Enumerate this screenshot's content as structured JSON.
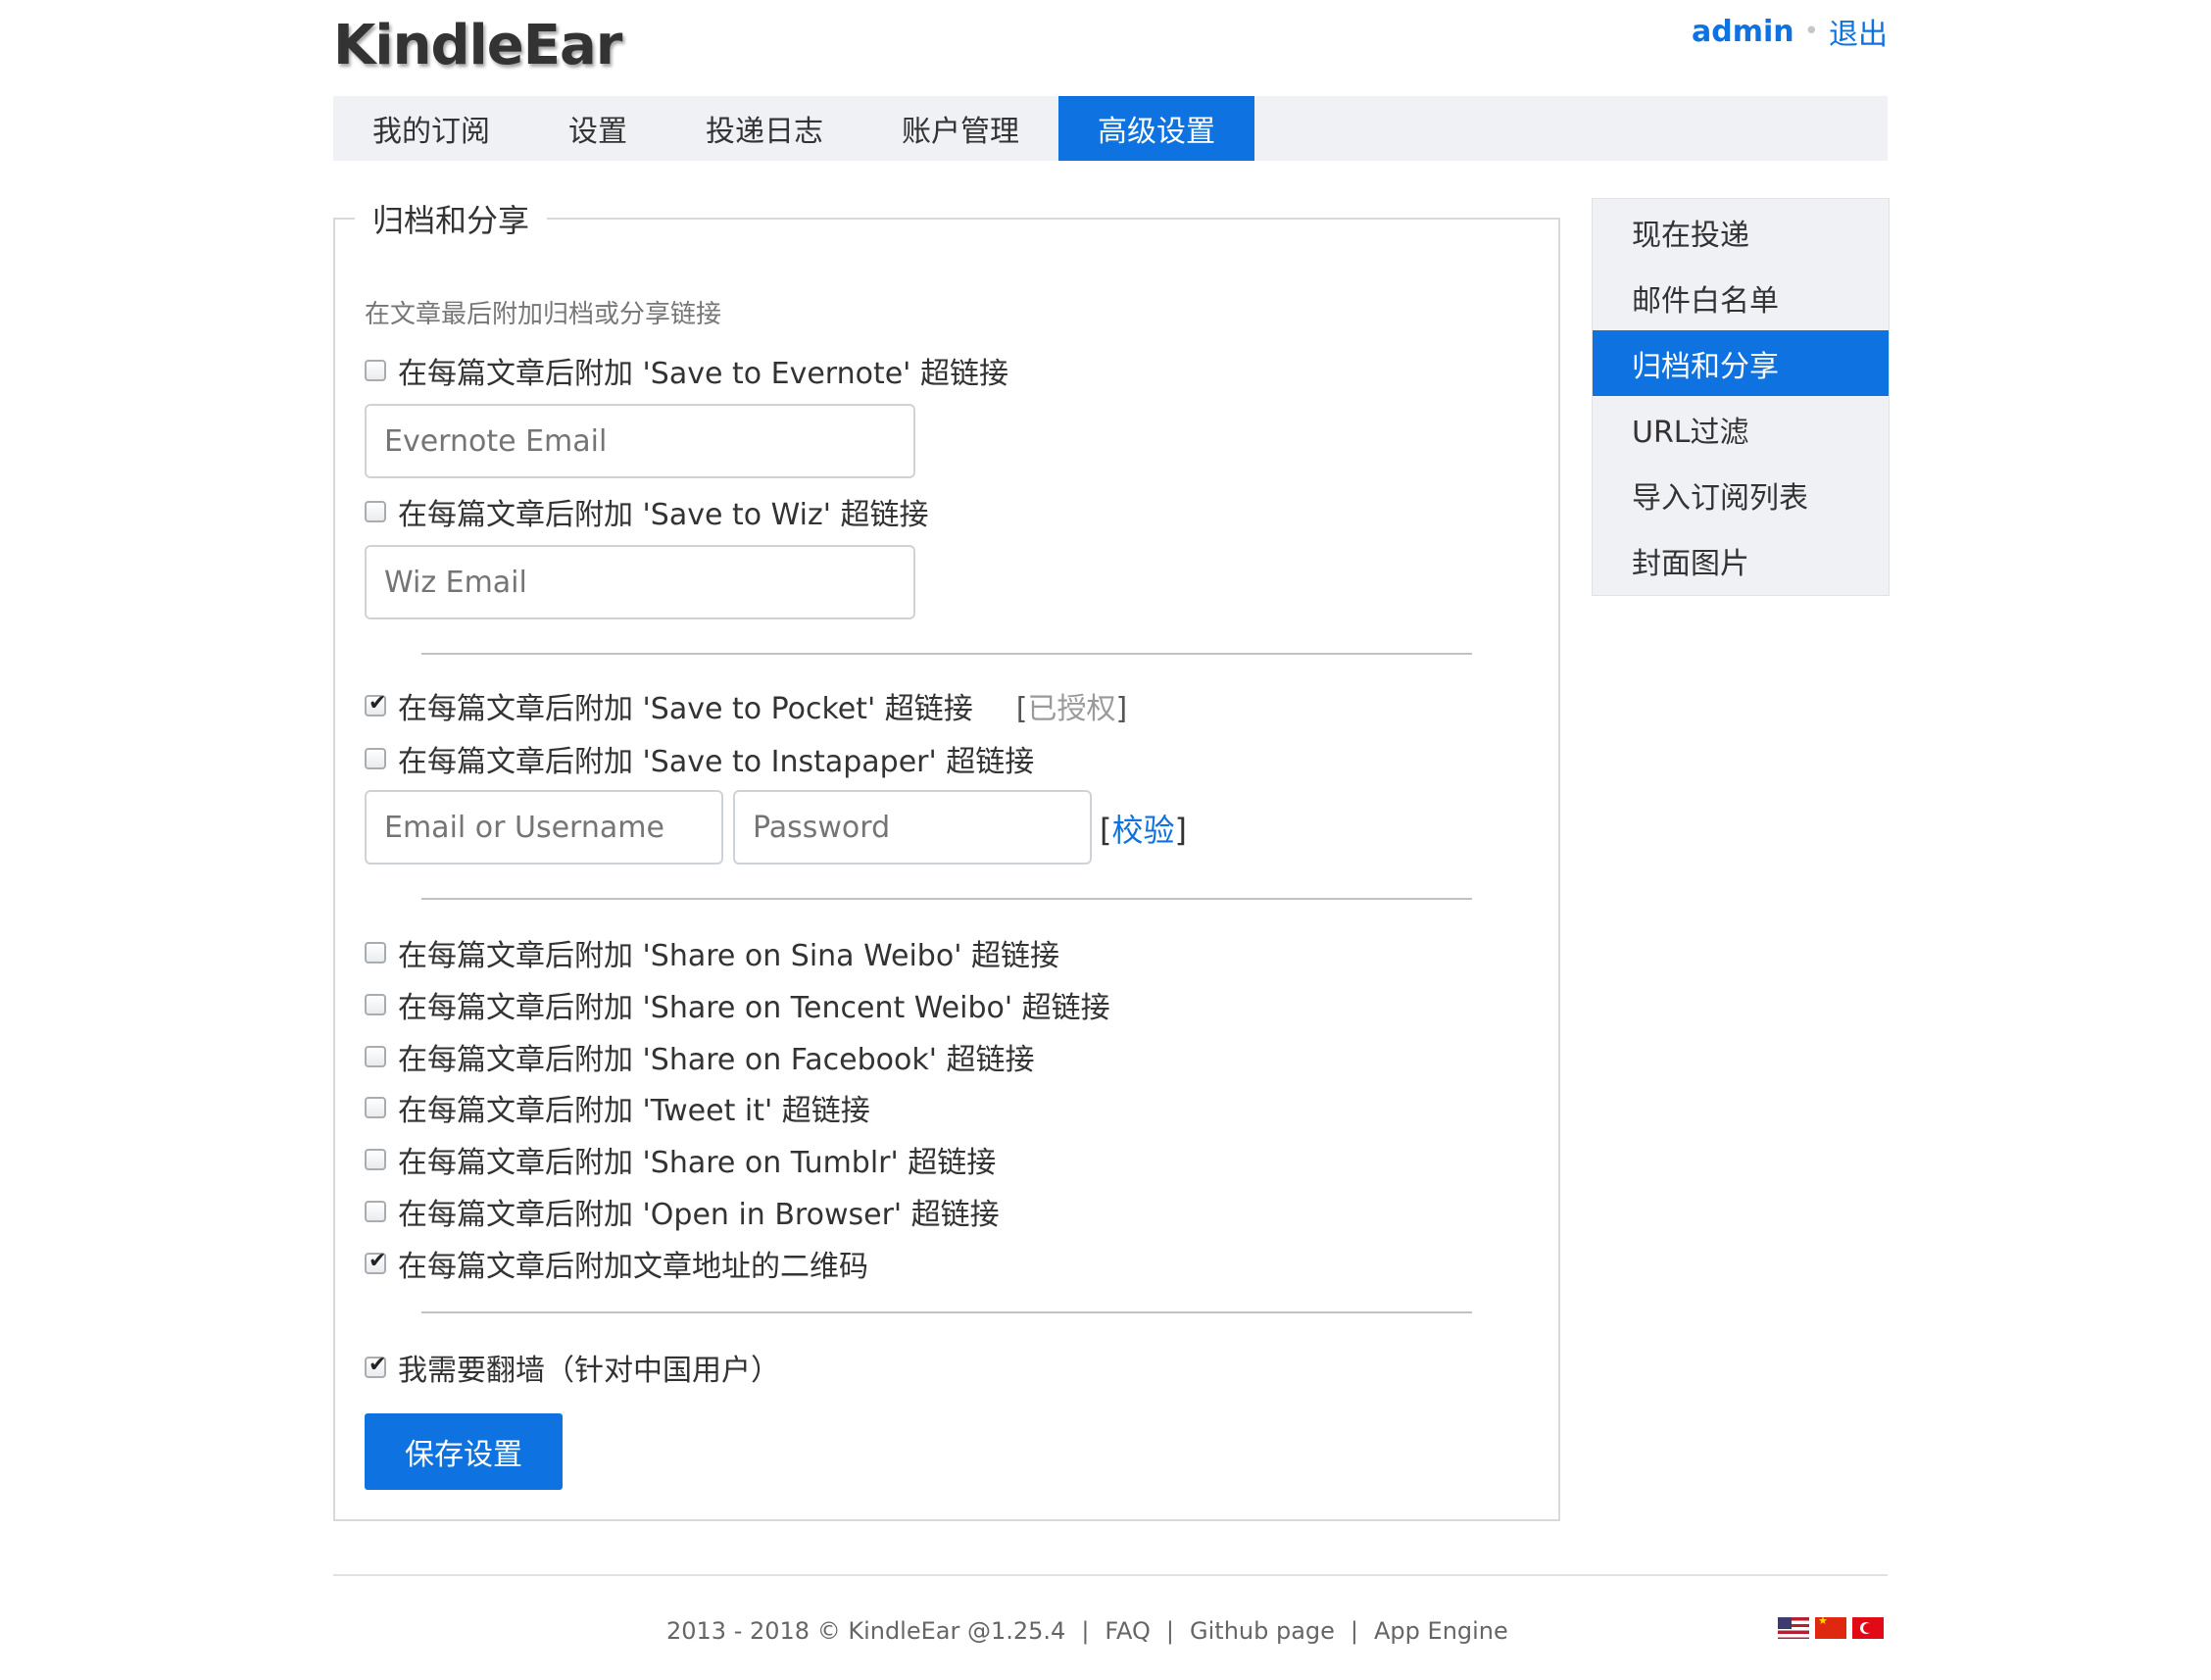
{
  "header": {
    "logo": "KindleEar",
    "user": "admin",
    "separator": "•",
    "logout": "退出"
  },
  "topnav": {
    "tabs": [
      {
        "label": "我的订阅",
        "active": false
      },
      {
        "label": "设置",
        "active": false
      },
      {
        "label": "投递日志",
        "active": false
      },
      {
        "label": "账户管理",
        "active": false
      },
      {
        "label": "高级设置",
        "active": true
      }
    ]
  },
  "panel": {
    "legend": "归档和分享",
    "hint": "在文章最后附加归档或分享链接",
    "evernote": {
      "label": "在每篇文章后附加 'Save to Evernote' 超链接",
      "checked": false,
      "placeholder": "Evernote Email"
    },
    "wiz": {
      "label": "在每篇文章后附加 'Save to Wiz' 超链接",
      "checked": false,
      "placeholder": "Wiz Email"
    },
    "pocket": {
      "label": "在每篇文章后附加 'Save to Pocket' 超链接",
      "checked": true,
      "status_open": "[",
      "status": "已授权",
      "status_close": "]"
    },
    "instapaper": {
      "label": "在每篇文章后附加 'Save to Instapaper' 超链接",
      "checked": false,
      "username_placeholder": "Email or Username",
      "password_placeholder": "Password",
      "verify_open": "[",
      "verify": "校验",
      "verify_close": "]"
    },
    "shares": [
      {
        "label": "在每篇文章后附加 'Share on Sina Weibo' 超链接",
        "checked": false
      },
      {
        "label": "在每篇文章后附加 'Share on Tencent Weibo' 超链接",
        "checked": false
      },
      {
        "label": "在每篇文章后附加 'Share on Facebook' 超链接",
        "checked": false
      },
      {
        "label": "在每篇文章后附加 'Tweet it' 超链接",
        "checked": false
      },
      {
        "label": "在每篇文章后附加 'Share on Tumblr' 超链接",
        "checked": false
      },
      {
        "label": "在每篇文章后附加 'Open in Browser' 超链接",
        "checked": false
      },
      {
        "label": "在每篇文章后附加文章地址的二维码",
        "checked": true
      }
    ],
    "gfw": {
      "label": "我需要翻墙（针对中国用户）",
      "checked": true
    },
    "save_button": "保存设置"
  },
  "sidemenu": {
    "items": [
      {
        "label": "现在投递",
        "active": false
      },
      {
        "label": "邮件白名单",
        "active": false
      },
      {
        "label": "归档和分享",
        "active": true
      },
      {
        "label": "URL过滤",
        "active": false
      },
      {
        "label": "导入订阅列表",
        "active": false
      },
      {
        "label": "封面图片",
        "active": false
      }
    ]
  },
  "footer": {
    "copyright": "2013 - 2018 © KindleEar @1.25.4",
    "pipe": "|",
    "faq": "FAQ",
    "github": "Github page",
    "appengine": "App Engine",
    "flags": [
      "us-flag-icon",
      "cn-flag-icon",
      "tr-flag-icon"
    ]
  },
  "colors": {
    "accent": "#0e73e0",
    "nav_bg": "#f0f1f5",
    "text": "#333333"
  }
}
